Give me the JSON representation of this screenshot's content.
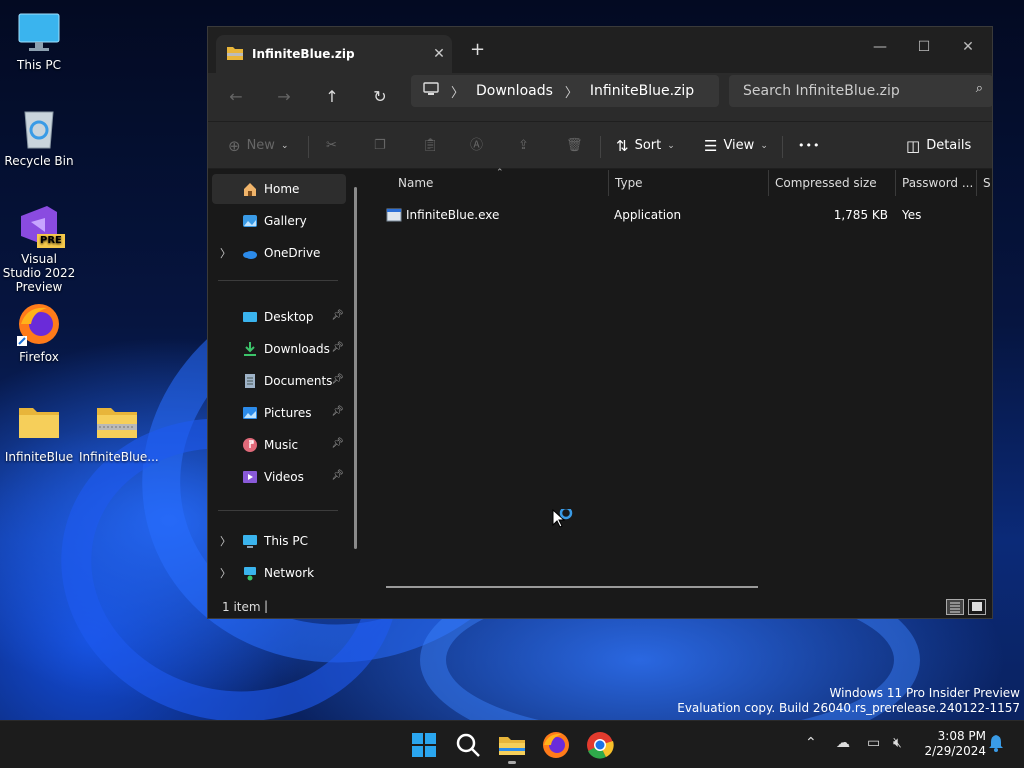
{
  "desktop": {
    "icons": [
      {
        "label": "This PC"
      },
      {
        "label": "Recycle Bin"
      },
      {
        "label": "Visual Studio 2022 Preview",
        "badge": "PRE"
      },
      {
        "label": "Firefox"
      },
      {
        "label": "InfiniteBlue"
      },
      {
        "label": "InfiniteBlue..."
      }
    ]
  },
  "window": {
    "tab_title": "InfiniteBlue.zip",
    "close_tab": "✕",
    "new_tab": "+",
    "address": {
      "crumbs": [
        "Downloads",
        "InfiniteBlue.zip"
      ]
    },
    "search_placeholder": "Search InfiniteBlue.zip",
    "commands": {
      "new": "New",
      "sort": "Sort",
      "view": "View",
      "more": "•••",
      "details": "Details"
    },
    "sidebar": {
      "home": "Home",
      "gallery": "Gallery",
      "onedrive": "OneDrive",
      "desktop": "Desktop",
      "downloads": "Downloads",
      "documents": "Documents",
      "pictures": "Pictures",
      "music": "Music",
      "videos": "Videos",
      "thispc": "This PC",
      "network": "Network"
    },
    "columns": {
      "name": "Name",
      "type": "Type",
      "compressed": "Compressed size",
      "password": "Password ...",
      "size": "Si"
    },
    "files": [
      {
        "name": "InfiniteBlue.exe",
        "type": "Application",
        "compressed": "1,785 KB",
        "password": "Yes"
      }
    ],
    "status": "1 item",
    "status_sep": "|"
  },
  "watermark": {
    "line1": "Windows 11 Pro Insider Preview",
    "line2": "Evaluation copy. Build 26040.rs_prerelease.240122-1157"
  },
  "taskbar": {
    "time": "3:08 PM",
    "date": "2/29/2024"
  },
  "colors": {
    "accent": "#0078d4",
    "folder": "#f6c94a"
  }
}
